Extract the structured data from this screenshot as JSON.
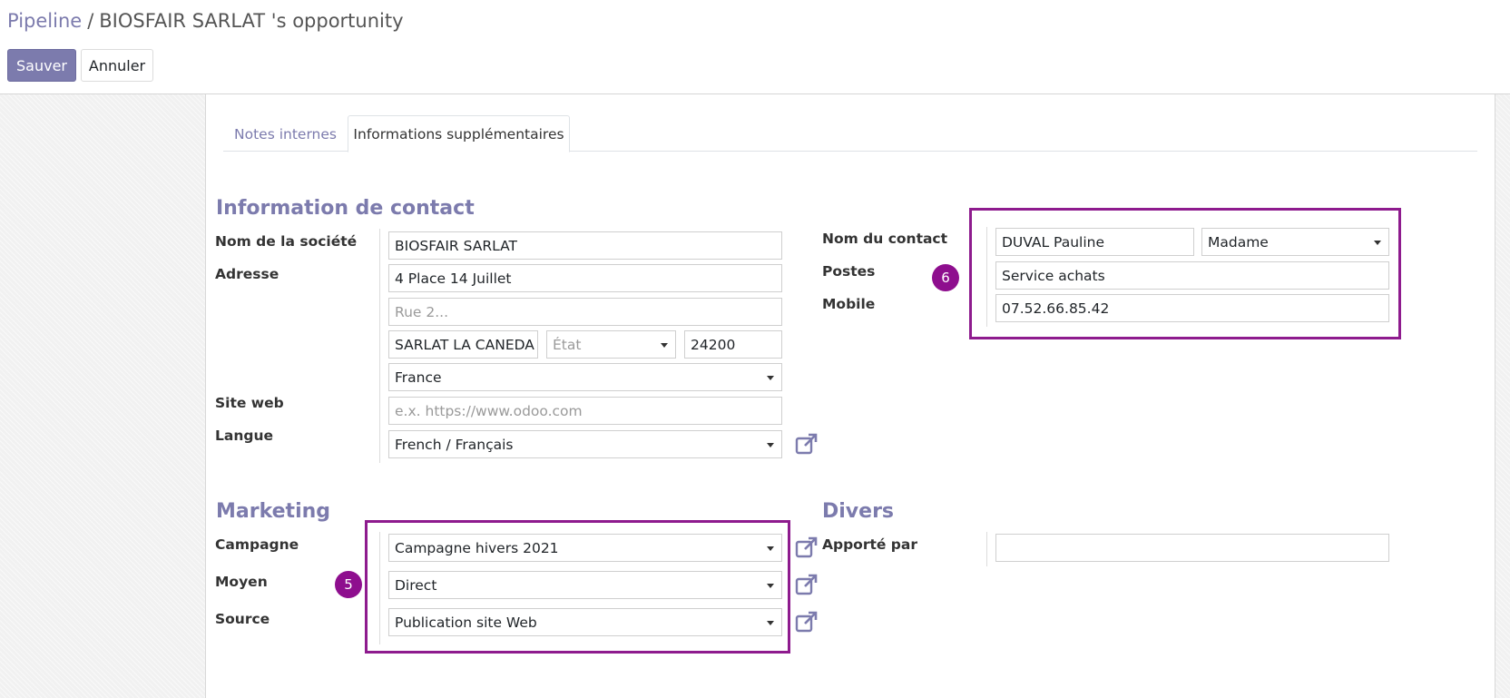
{
  "breadcrumb": {
    "root": "Pipeline",
    "separator": "/",
    "current": "BIOSFAIR SARLAT 's opportunity"
  },
  "buttons": {
    "save": "Sauver",
    "cancel": "Annuler"
  },
  "tabs": [
    {
      "label": "Notes internes",
      "active": false
    },
    {
      "label": "Informations supplémentaires",
      "active": true
    }
  ],
  "contact_info": {
    "title": "Information de contact",
    "company_label": "Nom de la société",
    "company_value": "BIOSFAIR SARLAT",
    "address_label": "Adresse",
    "street": "4 Place 14 Juillet",
    "street2_placeholder": "Rue 2...",
    "city": "SARLAT LA CANEDA",
    "state_placeholder": "État",
    "zip": "24200",
    "country": "France",
    "website_label": "Site web",
    "website_placeholder": "e.x. https://www.odoo.com",
    "language_label": "Langue",
    "language_value": "French / Français"
  },
  "contact_person": {
    "name_label": "Nom du contact",
    "name_value": "DUVAL Pauline",
    "title_value": "Madame",
    "job_label": "Postes",
    "job_value": "Service achats",
    "mobile_label": "Mobile",
    "mobile_value": "07.52.66.85.42"
  },
  "marketing": {
    "title": "Marketing",
    "campaign_label": "Campagne",
    "campaign_value": "Campagne hivers 2021",
    "medium_label": "Moyen",
    "medium_value": "Direct",
    "source_label": "Source",
    "source_value": "Publication site Web"
  },
  "misc": {
    "title": "Divers",
    "referred_label": "Apporté par",
    "referred_value": ""
  },
  "annotations": {
    "badge_marketing": "5",
    "badge_contact": "6",
    "highlight_color": "#8e1b8e"
  },
  "icons": {
    "external_link": "external-link-icon",
    "dropdown": "caret-down-icon"
  },
  "colors": {
    "brand": "#7c7bad"
  }
}
